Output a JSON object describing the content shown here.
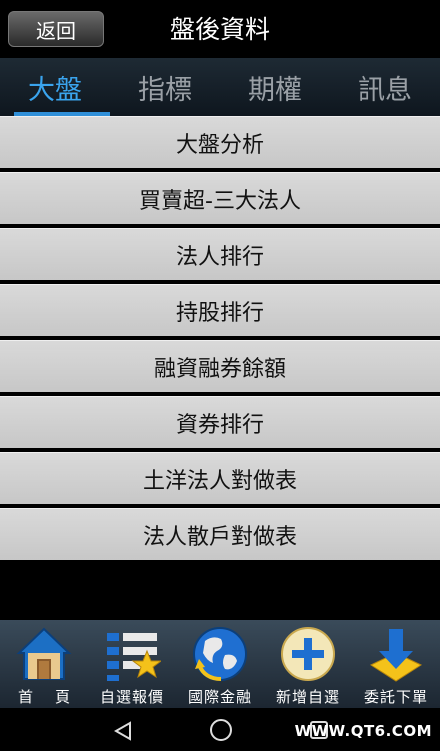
{
  "header": {
    "back_label": "返回",
    "title": "盤後資料"
  },
  "tabs": [
    {
      "label": "大盤",
      "active": true
    },
    {
      "label": "指標",
      "active": false
    },
    {
      "label": "期權",
      "active": false
    },
    {
      "label": "訊息",
      "active": false
    }
  ],
  "menu": {
    "items": [
      "大盤分析",
      "買賣超-三大法人",
      "法人排行",
      "持股排行",
      "融資融券餘額",
      "資券排行",
      "土洋法人對做表",
      "法人散戶對做表"
    ]
  },
  "toolbar": {
    "items": [
      {
        "label": "首頁",
        "icon": "home-icon"
      },
      {
        "label": "自選報價",
        "icon": "watchlist-icon"
      },
      {
        "label": "國際金融",
        "icon": "globe-icon"
      },
      {
        "label": "新增自選",
        "icon": "add-icon"
      },
      {
        "label": "委託下單",
        "icon": "download-order-icon"
      }
    ]
  },
  "watermark": "WWW.QT6.COM",
  "colors": {
    "active_tab": "#3aa4ee",
    "tab_text": "#9aa0a6",
    "menu_bg": "#d0d0d0",
    "toolbar_bg": "#2b3845"
  }
}
